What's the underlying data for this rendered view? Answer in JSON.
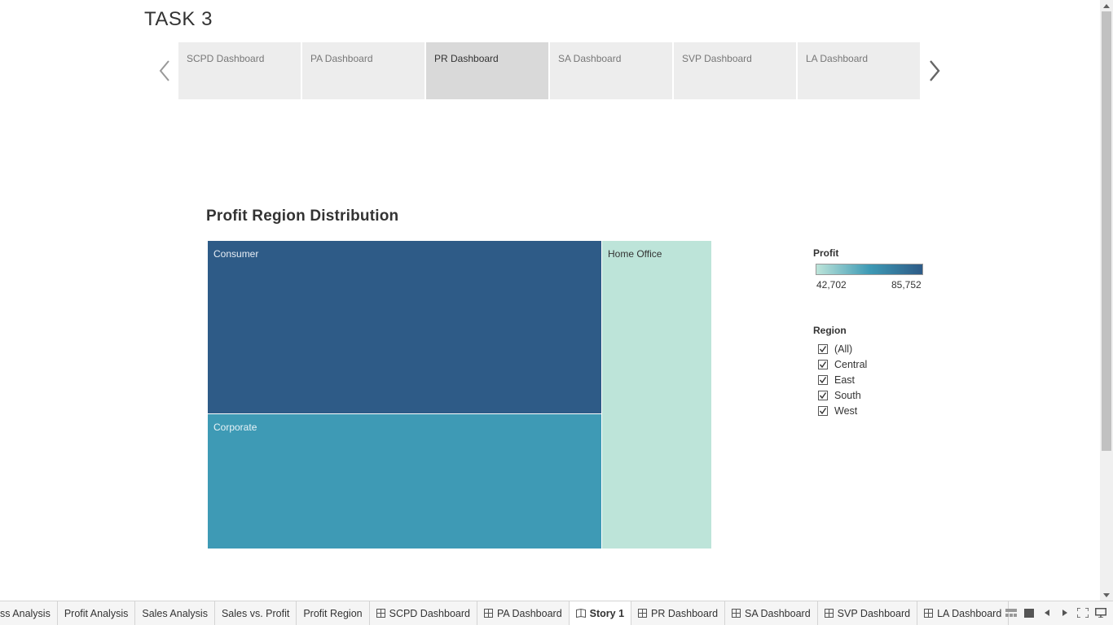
{
  "story": {
    "title": "TASK 3",
    "points": [
      {
        "label": "SCPD Dashboard",
        "active": false
      },
      {
        "label": "PA Dashboard",
        "active": false
      },
      {
        "label": "PR Dashboard",
        "active": true
      },
      {
        "label": "SA Dashboard",
        "active": false
      },
      {
        "label": "SVP Dashboard",
        "active": false
      },
      {
        "label": "LA Dashboard",
        "active": false
      }
    ]
  },
  "viz": {
    "title": "Profit Region Distribution"
  },
  "chart_data": {
    "type": "treemap",
    "title": "Profit Region Distribution",
    "tiles": [
      {
        "label": "Consumer",
        "color": "#2e5b87"
      },
      {
        "label": "Corporate",
        "color": "#3e9ab5"
      },
      {
        "label": "Home Office",
        "color": "#bde4d9"
      }
    ],
    "color_legend": {
      "title": "Profit",
      "min": "42,702",
      "max": "85,752",
      "min_color": "#bde4d9",
      "mid_color": "#3e9ab5",
      "max_color": "#2e5b87"
    }
  },
  "region_filter": {
    "title": "Region",
    "items": [
      {
        "label": "(All)",
        "checked": true
      },
      {
        "label": "Central",
        "checked": true
      },
      {
        "label": "East",
        "checked": true
      },
      {
        "label": "South",
        "checked": true
      },
      {
        "label": "West",
        "checked": true
      }
    ]
  },
  "sheet_tabs": [
    {
      "label": "ss Analysis",
      "icon": "none",
      "active": false
    },
    {
      "label": "Profit Analysis",
      "icon": "none",
      "active": false
    },
    {
      "label": "Sales Analysis",
      "icon": "none",
      "active": false
    },
    {
      "label": "Sales vs. Profit",
      "icon": "none",
      "active": false
    },
    {
      "label": "Profit Region",
      "icon": "none",
      "active": false
    },
    {
      "label": "SCPD Dashboard",
      "icon": "dashboard-icon",
      "active": false
    },
    {
      "label": "PA Dashboard",
      "icon": "dashboard-icon",
      "active": false
    },
    {
      "label": "Story 1",
      "icon": "story-icon",
      "active": true
    },
    {
      "label": "PR Dashboard",
      "icon": "dashboard-icon",
      "active": false
    },
    {
      "label": "SA Dashboard",
      "icon": "dashboard-icon",
      "active": false
    },
    {
      "label": "SVP Dashboard",
      "icon": "dashboard-icon",
      "active": false
    },
    {
      "label": "LA Dashboard",
      "icon": "dashboard-icon",
      "active": false
    }
  ]
}
